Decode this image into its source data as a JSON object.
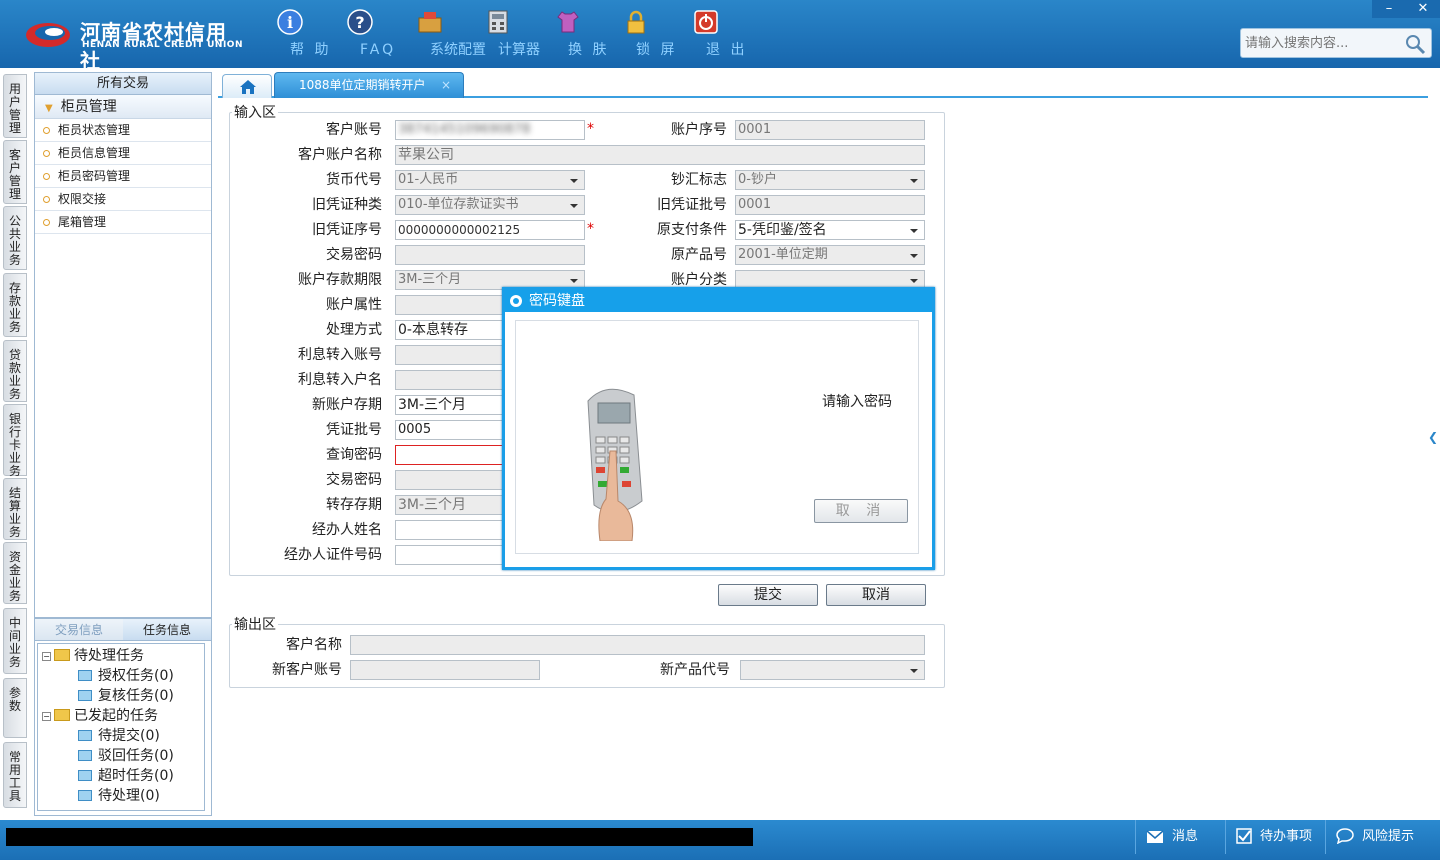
{
  "brand": {
    "name_cn": "河南省农村信用社",
    "name_en": "HENAN RURAL CREDIT UNION"
  },
  "toolbar": [
    {
      "label": "帮 助",
      "icon": "help-icon"
    },
    {
      "label": "FAQ",
      "icon": "faq-icon"
    },
    {
      "label": "系统配置",
      "icon": "toolbox-icon"
    },
    {
      "label": "计算器",
      "icon": "calculator-icon"
    },
    {
      "label": "换 肤",
      "icon": "shirt-icon"
    },
    {
      "label": "锁 屏",
      "icon": "lock-icon"
    },
    {
      "label": "退 出",
      "icon": "power-icon"
    }
  ],
  "search": {
    "placeholder": "请输入搜索内容..."
  },
  "vtabs": [
    "用户管理",
    "客户管理",
    "公共业务",
    "存款业务",
    "贷款业务",
    "银行卡业务",
    "结算业务",
    "资金业务",
    "中间业务",
    "参数",
    "常用工具"
  ],
  "sidebar": {
    "header": "所有交易",
    "group": "柜员管理",
    "items": [
      "柜员状态管理",
      "柜员信息管理",
      "柜员密码管理",
      "权限交接",
      "尾箱管理"
    ]
  },
  "tasks": {
    "tabs": [
      "交易信息",
      "任务信息"
    ],
    "pending": "待处理任务",
    "pending_children": [
      "授权任务(0)",
      "复核任务(0)"
    ],
    "initiated": "已发起的任务",
    "initiated_children": [
      "待提交(0)",
      "驳回任务(0)",
      "超时任务(0)",
      "待处理(0)"
    ]
  },
  "tabs": {
    "active": "1088单位定期销转开户",
    "close": "×"
  },
  "input_section": {
    "legend": "输入区",
    "labels": {
      "customer_account": "客户账号",
      "account_seq": "账户序号",
      "account_name": "客户账户名称",
      "currency": "货币代号",
      "cash_flag": "钞汇标志",
      "old_voucher_type": "旧凭证种类",
      "old_voucher_batch": "旧凭证批号",
      "old_voucher_seq": "旧凭证序号",
      "orig_pay_cond": "原支付条件",
      "trade_pwd": "交易密码",
      "orig_product": "原产品号",
      "deposit_term": "账户存款期限",
      "account_class": "账户分类",
      "account_attr": "账户属性",
      "handling": "处理方式",
      "interest_account": "利息转入账号",
      "interest_name": "利息转入户名",
      "new_term": "新账户存期",
      "voucher_batch": "凭证批号",
      "query_pwd": "查询密码",
      "trade_pwd2": "交易密码",
      "rollover_term": "转存存期",
      "agent_name": "经办人姓名",
      "agent_id": "经办人证件号码"
    },
    "values": {
      "customer_account": "3874145109690878",
      "account_seq": "0001",
      "account_name": "苹果公司",
      "currency": "01-人民币",
      "cash_flag": "0-钞户",
      "old_voucher_type": "010-单位存款证实书",
      "old_voucher_batch": "0001",
      "old_voucher_seq": "0000000000002125",
      "orig_pay_cond": "5-凭印鉴/签名",
      "orig_product": "2001-单位定期",
      "deposit_term": "3M-三个月",
      "handling": "0-本息转存",
      "new_term": "3M-三个月",
      "voucher_batch": "0005",
      "rollover_term": "3M-三个月"
    },
    "required_mark": "*",
    "submit": "提交",
    "cancel": "取消"
  },
  "output_section": {
    "legend": "输出区",
    "labels": {
      "customer_name": "客户名称",
      "new_account": "新客户账号",
      "new_product": "新产品代号"
    }
  },
  "dialog": {
    "title": "密码键盘",
    "prompt": "请输入密码",
    "cancel": "取 消"
  },
  "status": {
    "message": "消息",
    "todo": "待办事项",
    "risk": "风险提示"
  },
  "colors": {
    "brand_blue": "#1766ad",
    "accent": "#16a0ea",
    "required": "#dd0000"
  }
}
